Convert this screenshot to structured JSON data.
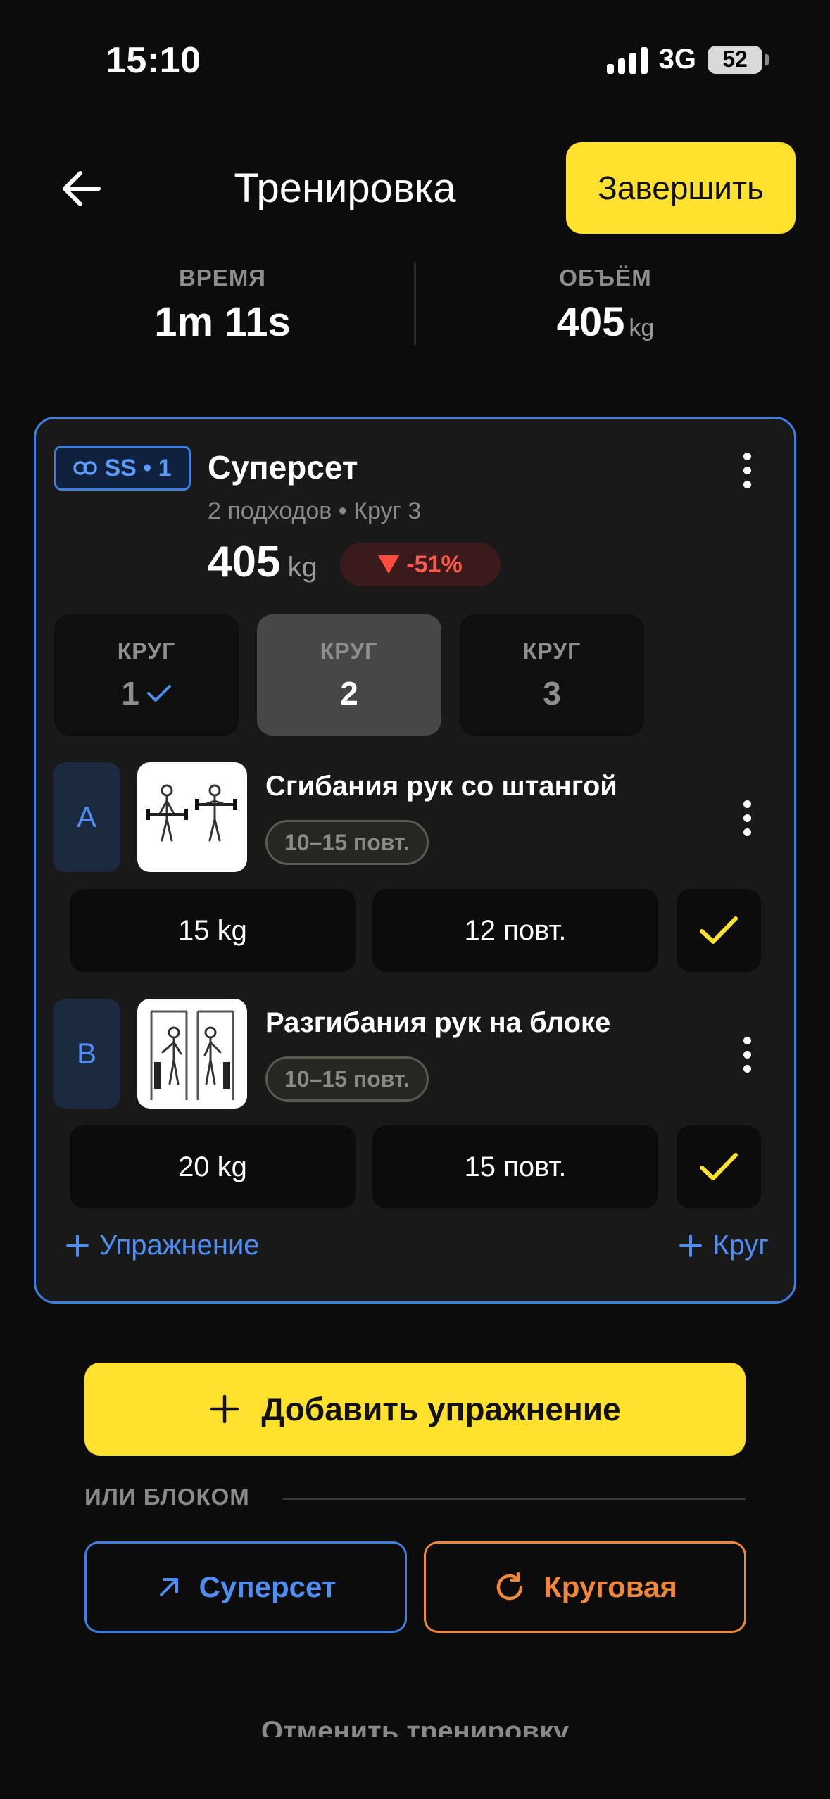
{
  "status_bar": {
    "time": "15:10",
    "network": "3G",
    "battery": "52"
  },
  "header": {
    "title": "Тренировка",
    "finish_label": "Завершить"
  },
  "stats": {
    "time_label": "ВРЕМЯ",
    "time_value": "1m 11s",
    "volume_label": "ОБЪЁМ",
    "volume_value": "405",
    "volume_unit": "kg"
  },
  "superset": {
    "badge": "SS • 1",
    "title": "Суперсет",
    "subtitle": "2 подходов • Круг 3",
    "volume": "405",
    "volume_unit": "kg",
    "delta": "-51%",
    "rounds": [
      {
        "label": "КРУГ",
        "number": "1",
        "done": true
      },
      {
        "label": "КРУГ",
        "number": "2",
        "active": true
      },
      {
        "label": "КРУГ",
        "number": "3"
      }
    ],
    "exercises": [
      {
        "letter": "A",
        "name": "Сгибания рук со штангой",
        "reps_range": "10–15 повт.",
        "weight": "15 kg",
        "reps": "12 повт.",
        "completed": true
      },
      {
        "letter": "B",
        "name": "Разгибания рук на блоке",
        "reps_range": "10–15 повт.",
        "weight": "20 kg",
        "reps": "15 повт.",
        "completed": true
      }
    ],
    "add_exercise_link": "Упражнение",
    "add_round_link": "Круг"
  },
  "actions": {
    "add_exercise": "Добавить упражнение",
    "or_block": "ИЛИ БЛОКОМ",
    "superset": "Суперсет",
    "circuit": "Круговая",
    "cancel": "Отменить тренировку"
  },
  "colors": {
    "accent_yellow": "#ffe12e",
    "accent_blue": "#3f7fe0",
    "accent_orange": "#f0883a",
    "danger": "#ff4b3e"
  }
}
